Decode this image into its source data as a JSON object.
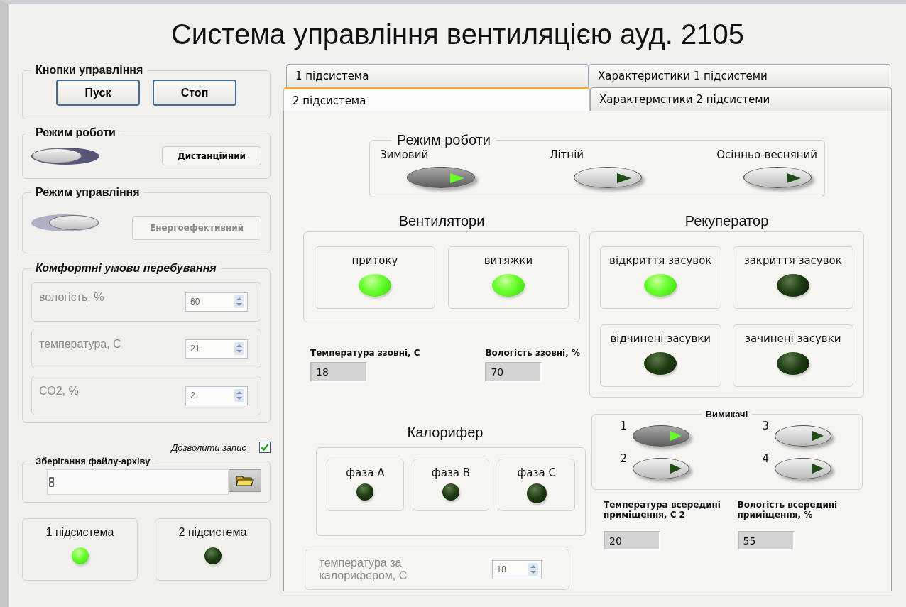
{
  "title": "Система управління вентиляцією ауд. 2105",
  "control_buttons": {
    "label": "Кнопки управління",
    "buttons": [
      "Пуск",
      "Стоп"
    ]
  },
  "operation_mode": {
    "label": "Режим роботи",
    "on": false,
    "disabled": false,
    "button": "Дистанційний"
  },
  "control_mode": {
    "label": "Режим управління",
    "on": true,
    "disabled": true,
    "button": "Енергоефективний"
  },
  "comfort": {
    "label": "Комфортні умови перебування",
    "disabled": true,
    "fields": [
      {
        "label": "вологість, %",
        "value": "60"
      },
      {
        "label": "температура, С",
        "value": "21"
      },
      {
        "label": "СО2, %",
        "value": "2"
      }
    ]
  },
  "allow_write": {
    "label": "Дозволити запис",
    "checked": true
  },
  "archive": {
    "label": "Зберігання файлу-архіву"
  },
  "subsystem_lamps": [
    {
      "label": "1 підсистема",
      "on": true
    },
    {
      "label": "2 підсистема",
      "on": false
    }
  ],
  "tab_rows": [
    [
      {
        "label": "1 підсистема",
        "selected": false
      },
      {
        "label": "Характеристики 1 підсистеми",
        "selected": false
      }
    ],
    [
      {
        "label": "2 підсистема",
        "selected": true
      },
      {
        "label": "Характермстики 2 підсистеми",
        "selected": false
      }
    ]
  ],
  "panel": {
    "mode": {
      "label": "Режим роботи",
      "options": [
        {
          "label": "Зимовий",
          "on": true
        },
        {
          "label": "Літній",
          "on": false
        },
        {
          "label": "Осінньо-весняний",
          "on": false
        }
      ]
    },
    "fans": {
      "title": "Вентилятори",
      "lamps": [
        {
          "label": "притоку",
          "on": true
        },
        {
          "label": "витяжки",
          "on": true
        }
      ]
    },
    "outside": [
      {
        "label": "Температура ззовні, С",
        "value": "18"
      },
      {
        "label": "Вологість ззовні, %",
        "value": "70"
      }
    ],
    "heater": {
      "title": "Калорифер",
      "lamps": [
        {
          "label": "фаза А",
          "on": false
        },
        {
          "label": "фаза В",
          "on": false
        },
        {
          "label": "фаза С",
          "on": false
        }
      ]
    },
    "heater_temp": {
      "label": "температура за калорифером, С",
      "value": "18",
      "disabled": true
    },
    "recuperator": {
      "title": "Рекуператор",
      "lamps": [
        {
          "label": "відкриття засувок",
          "on": true
        },
        {
          "label": "закриття засувок",
          "on": false
        },
        {
          "label": "відчинені засувки",
          "on": false
        },
        {
          "label": "зачинені засувки",
          "on": false
        }
      ]
    },
    "switches": {
      "label": "Вимикачі",
      "items": [
        {
          "label": "1",
          "on": true
        },
        {
          "label": "2",
          "on": false
        },
        {
          "label": "3",
          "on": false
        },
        {
          "label": "4",
          "on": false
        }
      ]
    },
    "inside": [
      {
        "label": "Температура всередині приміщення, С 2",
        "value": "20"
      },
      {
        "label": "Вологість всередині приміщення, %",
        "value": "55"
      }
    ]
  }
}
